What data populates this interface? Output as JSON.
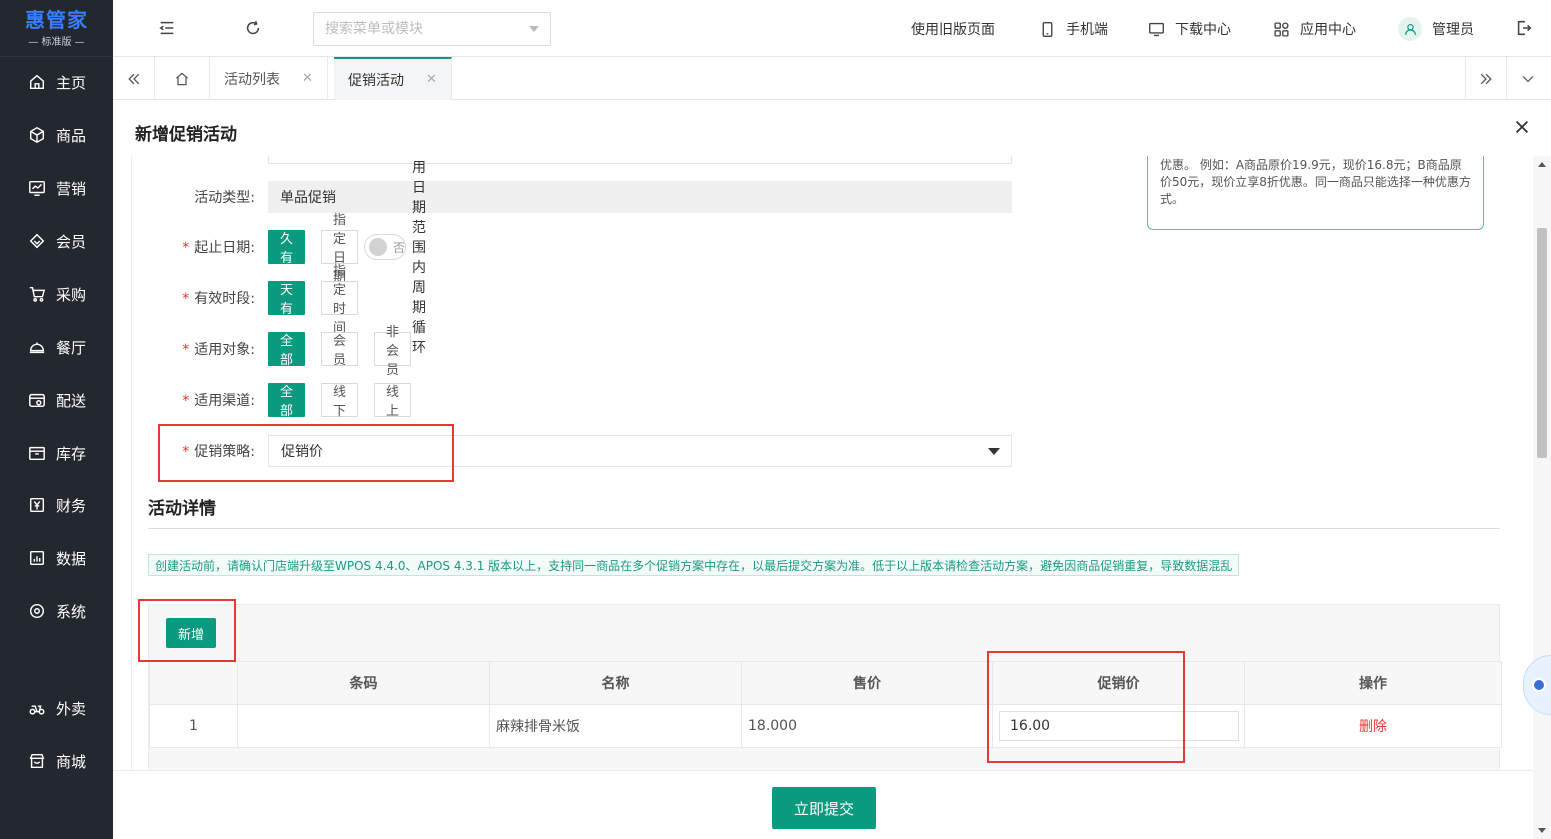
{
  "brand": {
    "name": "惠管家",
    "edition": "— 标准版 —"
  },
  "sidebar": {
    "items": [
      {
        "label": "主页",
        "icon": "home-icon"
      },
      {
        "label": "商品",
        "icon": "box-icon"
      },
      {
        "label": "营销",
        "icon": "chart-icon"
      },
      {
        "label": "会员",
        "icon": "diamond-icon"
      },
      {
        "label": "采购",
        "icon": "cart-icon"
      },
      {
        "label": "餐厅",
        "icon": "dish-icon"
      },
      {
        "label": "配送",
        "icon": "delivery-icon"
      },
      {
        "label": "库存",
        "icon": "archive-icon"
      },
      {
        "label": "财务",
        "icon": "yen-icon"
      },
      {
        "label": "数据",
        "icon": "data-icon"
      },
      {
        "label": "系统",
        "icon": "settings-icon"
      },
      {
        "label": "外卖",
        "icon": "scooter-icon"
      },
      {
        "label": "商城",
        "icon": "store-icon"
      }
    ]
  },
  "header": {
    "search_placeholder": "搜索菜单或模块",
    "links": {
      "old_page": "使用旧版页面",
      "mobile": "手机端",
      "download": "下载中心",
      "apps": "应用中心",
      "user": "管理员"
    }
  },
  "tabs": [
    {
      "label": "活动列表",
      "active": false
    },
    {
      "label": "促销活动",
      "active": true
    }
  ],
  "panel": {
    "title": "新增促销活动",
    "hint": "针对选择的商品范围，以促销价、促销折扣的形式实现的优惠。 例如：A商品原价19.9元，现价16.8元；B商品原价50元，现价立享8折优惠。同一商品只能选择一种优惠方式。",
    "form": {
      "activity_type": {
        "label": "活动类型:",
        "value": "单品促销"
      },
      "date_range": {
        "label": "起止日期:",
        "options": [
          "永久有效",
          "指定日期"
        ],
        "toggle_text": "否",
        "cycle_label": "启用日期范围内周期循环"
      },
      "time_range": {
        "label": "有效时段:",
        "options": [
          "全天有效",
          "指定时间"
        ]
      },
      "target": {
        "label": "适用对象:",
        "options": [
          "全部",
          "会员",
          "非会员"
        ]
      },
      "channel": {
        "label": "适用渠道:",
        "options": [
          "全部",
          "线下",
          "线上"
        ]
      },
      "strategy": {
        "label": "促销策略:",
        "value": "促销价"
      }
    },
    "details": {
      "title": "活动详情",
      "notice": "创建活动前，请确认门店端升级至WPOS 4.4.0、APOS 4.3.1 版本以上，支持同一商品在多个促销方案中存在，以最后提交方案为准。低于以上版本请检查活动方案，避免因商品促销重复，导致数据混乱",
      "add_label": "新增",
      "columns": [
        "",
        "条码",
        "名称",
        "售价",
        "促销价",
        "操作"
      ],
      "rows": [
        {
          "index": "1",
          "barcode": "",
          "name": "麻辣排骨米饭",
          "price": "18.000",
          "promo_price": "16.00",
          "action": "删除"
        }
      ]
    },
    "submit_label": "立即提交"
  },
  "colors": {
    "primary": "#0a9a80",
    "sidebar_bg": "#23272e",
    "highlight": "#e53935"
  }
}
